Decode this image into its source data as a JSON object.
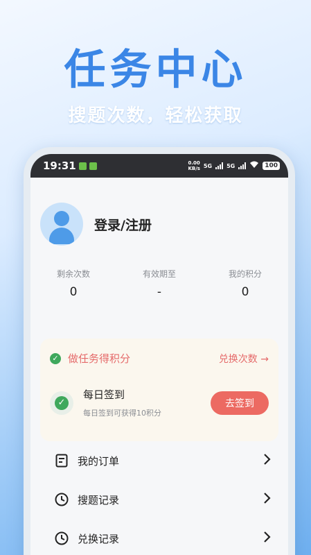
{
  "hero": {
    "title": "任务中心",
    "subtitle": "搜题次数，轻松获取"
  },
  "statusbar": {
    "time": "19:31",
    "net_speed_value": "0.00",
    "net_speed_unit": "KB/s",
    "network_1": "5G",
    "network_2": "5G",
    "battery": "100"
  },
  "profile": {
    "login_label": "登录/注册"
  },
  "stats": [
    {
      "label": "剩余次数",
      "value": "0"
    },
    {
      "label": "有效期至",
      "value": "-"
    },
    {
      "label": "我的积分",
      "value": "0"
    }
  ],
  "task_card": {
    "title": "做任务得积分",
    "exchange_link": "兑换次数 →",
    "signin_title": "每日签到",
    "signin_desc": "每日签到可获得10积分",
    "signin_button": "去签到"
  },
  "menu": [
    {
      "label": "我的订单",
      "icon": "order-icon"
    },
    {
      "label": "搜题记录",
      "icon": "clock-icon"
    },
    {
      "label": "兑换记录",
      "icon": "clock-icon"
    }
  ],
  "colors": {
    "accent_blue": "#3b86e6",
    "accent_red": "#ec6a62",
    "success_green": "#3fa85c"
  }
}
